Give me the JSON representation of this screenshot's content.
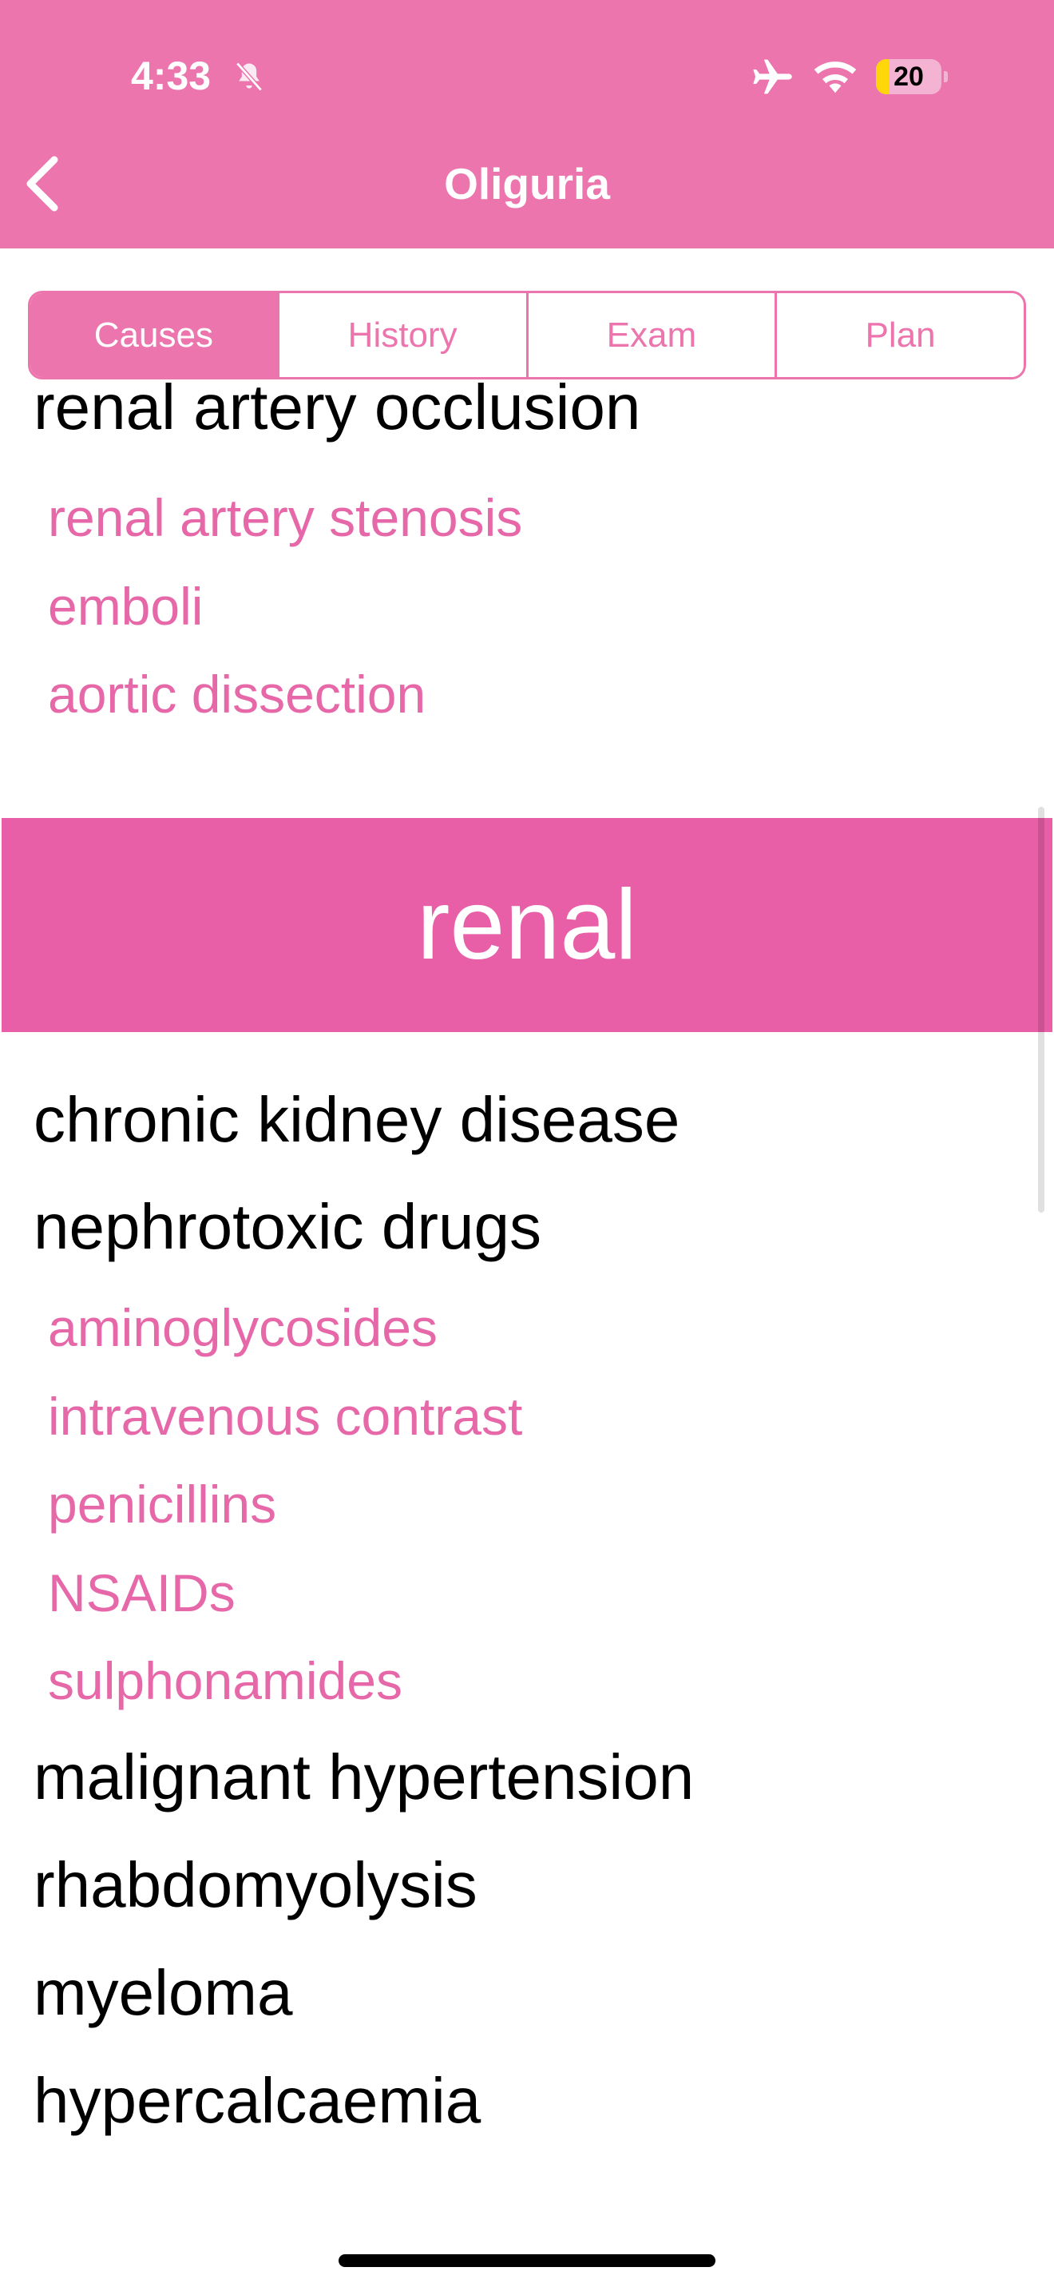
{
  "status_bar": {
    "time": "4:33",
    "battery_level": "20",
    "battery_fraction": 0.2,
    "icons": [
      "bell-slash-icon",
      "airplane-icon",
      "wifi-icon",
      "battery-icon"
    ]
  },
  "nav": {
    "title": "Oliguria",
    "back_icon": "chevron-left-icon"
  },
  "tabs": [
    {
      "label": "Causes",
      "selected": true
    },
    {
      "label": "History",
      "selected": false
    },
    {
      "label": "Exam",
      "selected": false
    },
    {
      "label": "Plan",
      "selected": false
    }
  ],
  "content": {
    "prerenal_partial": {
      "heading": "renal artery occlusion",
      "subitems": [
        "renal artery stenosis",
        "emboli",
        "aortic dissection"
      ]
    },
    "renal_section": {
      "title": "renal",
      "items": [
        {
          "label": "chronic kidney disease"
        },
        {
          "label": "nephrotoxic drugs",
          "subitems": [
            "aminoglycosides",
            "intravenous contrast",
            "penicillins",
            "NSAIDs",
            "sulphonamides"
          ]
        },
        {
          "label": "malignant hypertension"
        },
        {
          "label": "rhabdomyolysis"
        },
        {
          "label": "myeloma"
        },
        {
          "label": "hypercalcaemia"
        }
      ]
    }
  },
  "colors": {
    "accent": "#ec75ad",
    "section_band": "#e85ea7",
    "subitem_text": "#e668a8"
  }
}
